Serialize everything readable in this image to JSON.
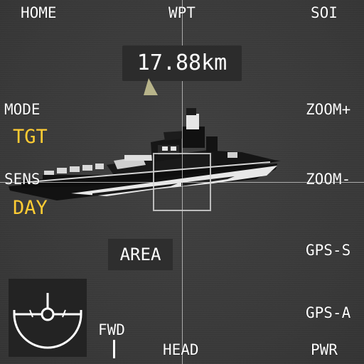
{
  "top": {
    "home_label": "HOME",
    "wpt_label": "WPT",
    "soi_label": "SOI"
  },
  "left": {
    "mode_label": "MODE",
    "mode_value": "TGT",
    "sens_label": "SENS",
    "sens_value": "DAY"
  },
  "right": {
    "zoom_in_label": "ZOOM+",
    "zoom_out_label": "ZOOM-",
    "gps_s_label": "GPS-S",
    "gps_a_label": "GPS-A"
  },
  "bottom": {
    "fwd_label": "FWD",
    "head_label": "HEAD",
    "pwr_label": "PWR"
  },
  "center": {
    "range_text": "17.88km",
    "area_label": "AREA"
  },
  "colors": {
    "value_accent": "#ffcc33",
    "background": "#3b3b3b"
  },
  "icons": {
    "compass": "gimbal-attitude-indicator",
    "pointer": "range-pointer-triangle",
    "target": "warship-target"
  }
}
